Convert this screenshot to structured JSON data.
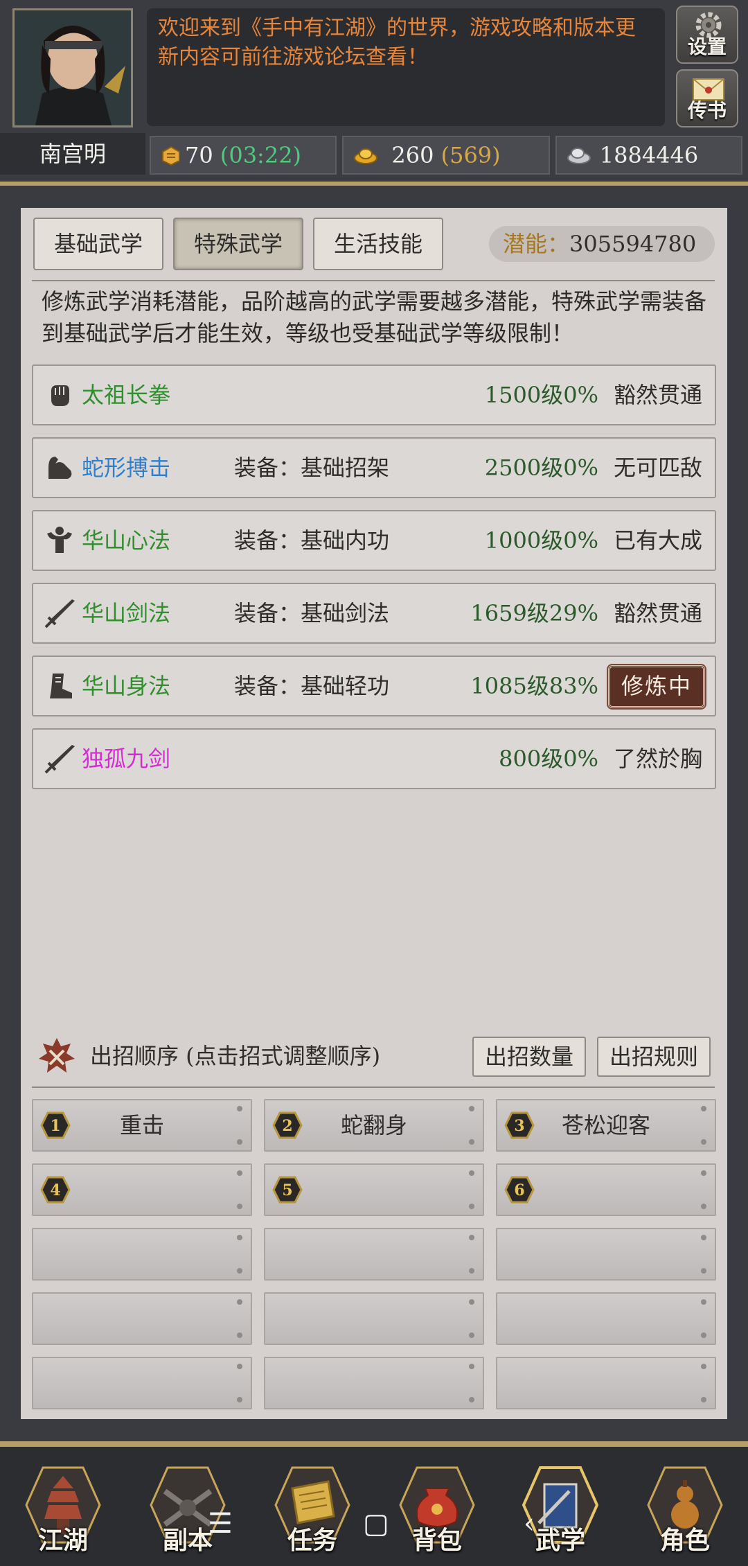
{
  "player": {
    "name": "南宫明"
  },
  "notice": {
    "text": "欢迎来到《手中有江湖》的世界，游戏攻略和版本更新内容可前往游戏论坛查看！"
  },
  "side_buttons": {
    "settings": "设置",
    "mail": "传书"
  },
  "resources": [
    {
      "value": "70",
      "extra": "(03:22)",
      "icon": "stamina-icon"
    },
    {
      "value": "260",
      "extra": "(569)",
      "icon": "gold-ingot-icon"
    },
    {
      "value": "1884446",
      "extra": "",
      "icon": "silver-icon"
    }
  ],
  "tabs": [
    {
      "label": "基础武学",
      "active": false
    },
    {
      "label": "特殊武学",
      "active": true
    },
    {
      "label": "生活技能",
      "active": false
    }
  ],
  "potential": {
    "label": "潜能：",
    "value": "305594780"
  },
  "description": "修炼武学消耗潜能，品阶越高的武学需要越多潜能，特殊武学需装备到基础武学后才能生效，等级也受基础武学等级限制！",
  "skills": [
    {
      "name": "太祖长拳",
      "equip": "",
      "level": "1500级0%",
      "status": "豁然贯通",
      "color": "#2e8f2c",
      "icon": "fist-icon"
    },
    {
      "name": "蛇形搏击",
      "equip": "装备：基础招架",
      "level": "2500级0%",
      "status": "无可匹敌",
      "color": "#2e7fd0",
      "icon": "arm-icon"
    },
    {
      "name": "华山心法",
      "equip": "装备：基础内功",
      "level": "1000级0%",
      "status": "已有大成",
      "color": "#2e8f2c",
      "icon": "strength-icon"
    },
    {
      "name": "华山剑法",
      "equip": "装备：基础剑法",
      "level": "1659级29%",
      "status": "豁然贯通",
      "color": "#2e8f2c",
      "icon": "sword-icon"
    },
    {
      "name": "华山身法",
      "equip": "装备：基础轻功",
      "level": "1085级83%",
      "status": "修炼中",
      "color": "#2e8f2c",
      "icon": "boot-icon"
    },
    {
      "name": "独孤九剑",
      "equip": "",
      "level": "800级0%",
      "status": "了然於胸",
      "color": "#d62ad6",
      "icon": "sword-icon"
    }
  ],
  "order": {
    "title": "出招顺序 (点击招式调整顺序)",
    "count_button": "出招数量",
    "rule_button": "出招规则",
    "slots": [
      {
        "num": "1",
        "move": "重击"
      },
      {
        "num": "2",
        "move": "蛇翻身"
      },
      {
        "num": "3",
        "move": "苍松迎客"
      },
      {
        "num": "4",
        "move": ""
      },
      {
        "num": "5",
        "move": ""
      },
      {
        "num": "6",
        "move": ""
      }
    ]
  },
  "nav": [
    {
      "label": "江湖",
      "icon": "pagoda-icon"
    },
    {
      "label": "副本",
      "icon": "dungeon-icon"
    },
    {
      "label": "任务",
      "icon": "scroll-icon"
    },
    {
      "label": "背包",
      "icon": "bag-icon"
    },
    {
      "label": "武学",
      "icon": "book-icon"
    },
    {
      "label": "角色",
      "icon": "gourd-icon"
    }
  ],
  "system_nav": {
    "menu": "☰",
    "home": "▢",
    "back": "‹"
  }
}
